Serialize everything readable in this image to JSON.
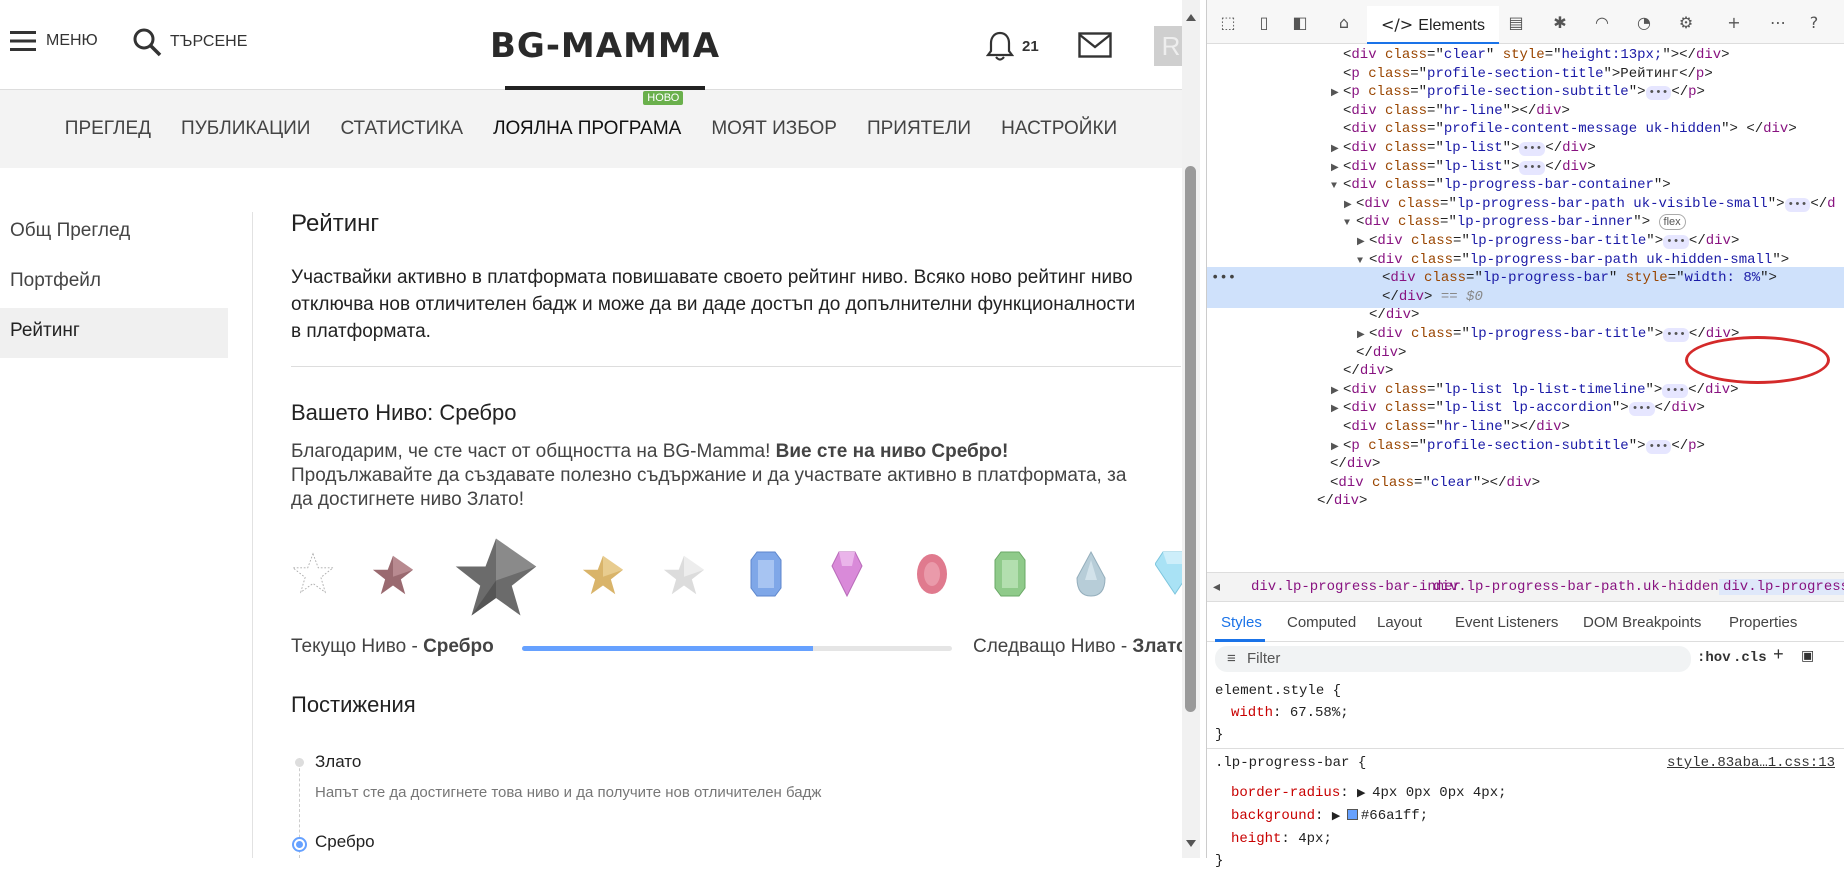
{
  "site": {
    "menu_label": "МЕНЮ",
    "search_label": "ТЪРСЕНЕ",
    "logo_text": "BG-MAMMA",
    "notifications_count": "21",
    "avatar_letter": "R",
    "tabs": [
      {
        "label": "ПРЕГЛЕД"
      },
      {
        "label": "ПУБЛИКАЦИИ"
      },
      {
        "label": "СТАТИСТИКА"
      },
      {
        "label": "ЛОЯЛНА ПРОГРАМА",
        "badge": "НОВО"
      },
      {
        "label": "МОЯТ ИЗБОР"
      },
      {
        "label": "ПРИЯТЕЛИ"
      },
      {
        "label": "НАСТРОЙКИ"
      }
    ],
    "sidebar": [
      {
        "label": "Общ Преглед"
      },
      {
        "label": "Портфейл"
      },
      {
        "label": "Рейтинг"
      }
    ],
    "section_title": "Рейтинг",
    "intro_lines": [
      "Участвайки активно в платформата повишавате своето рейтинг ниво. Всяко ново рейтинг ниво",
      "отключва нов отличителен бадж и може да ви даде достъп до допълнителни функционалности",
      "в платформата."
    ],
    "level_title": "Вашето Ниво: Сребро",
    "thanks_prefix": "Благодарим, че сте част от общността на BG-Mamma! ",
    "thanks_bold": "Вие сте на ниво Сребро!",
    "thanks_line2": "Продължавайте да създавате полезно съдържание и да участвате активно в платформата, за",
    "thanks_line3": "да достигнете ниво Злато!",
    "current_level_label": "Текущо Ниво - ",
    "current_level_value": "Сребро",
    "next_level_label": "Следващо Ниво - ",
    "next_level_value": "Злато",
    "progress_fraction": 0.6758,
    "achievements_title": "Постижения",
    "timeline": [
      {
        "name": "Злато",
        "desc": "Напът сте да достигнете това ниво и да получите нов отличителен бадж"
      },
      {
        "name": "Сребро"
      }
    ],
    "colors": {
      "accent": "#66a1ff",
      "new_badge": "#6ab04c"
    }
  },
  "devtools": {
    "elements_tab": "Elements",
    "dom_lines": [
      {
        "ind": 0,
        "tri": "",
        "html": "&lt;<span class='tg'>div</span> <span class='at'>class</span>=\"<span class='av'>clear</span>\" <span class='at'>style</span>=\"<span class='av'>height:13px;</span>\"&gt;&lt;/<span class='tg'>div</span>&gt;"
      },
      {
        "ind": 0,
        "tri": "",
        "html": "&lt;<span class='tg'>p</span> <span class='at'>class</span>=\"<span class='av'>profile-section-title</span>\"&gt;Рейтинг&lt;/<span class='tg'>p</span>&gt;"
      },
      {
        "ind": 0,
        "tri": "▶",
        "html": "&lt;<span class='tg'>p</span> <span class='at'>class</span>=\"<span class='av'>profile-section-subtitle</span>\"&gt;<span class='ell'>•••</span>&lt;/<span class='tg'>p</span>&gt;"
      },
      {
        "ind": 0,
        "tri": "",
        "html": "&lt;<span class='tg'>div</span> <span class='at'>class</span>=\"<span class='av'>hr-line</span>\"&gt;&lt;/<span class='tg'>div</span>&gt;"
      },
      {
        "ind": 0,
        "tri": "",
        "html": "&lt;<span class='tg'>div</span> <span class='at'>class</span>=\"<span class='av'>profile-content-message uk-hidden</span>\"&gt; &lt;/<span class='tg'>div</span>&gt;"
      },
      {
        "ind": 0,
        "tri": "▶",
        "html": "&lt;<span class='tg'>div</span> <span class='at'>class</span>=\"<span class='av'>lp-list</span>\"&gt;<span class='ell'>•••</span>&lt;/<span class='tg'>div</span>&gt;"
      },
      {
        "ind": 0,
        "tri": "▶",
        "html": "&lt;<span class='tg'>div</span> <span class='at'>class</span>=\"<span class='av'>lp-list</span>\"&gt;<span class='ell'>•••</span>&lt;/<span class='tg'>div</span>&gt;"
      },
      {
        "ind": 0,
        "tri": "▼",
        "html": "&lt;<span class='tg'>div</span> <span class='at'>class</span>=\"<span class='av'>lp-progress-bar-container</span>\"&gt;"
      },
      {
        "ind": 1,
        "tri": "▶",
        "html": "&lt;<span class='tg'>div</span> <span class='at'>class</span>=\"<span class='av'>lp-progress-bar-path uk-visible-small</span>\"&gt;<span class='ell'>•••</span>&lt;/<span class='tg'>d</span>"
      },
      {
        "ind": 1,
        "tri": "▼",
        "html": "&lt;<span class='tg'>div</span> <span class='at'>class</span>=\"<span class='av'>lp-progress-bar-inner</span>\"&gt; <span class='flexb'>flex</span>"
      },
      {
        "ind": 2,
        "tri": "▶",
        "html": "&lt;<span class='tg'>div</span> <span class='at'>class</span>=\"<span class='av'>lp-progress-bar-title</span>\"&gt;<span class='ell'>•••</span>&lt;/<span class='tg'>div</span>&gt;"
      },
      {
        "ind": 2,
        "tri": "▼",
        "html": "&lt;<span class='tg'>div</span> <span class='at'>class</span>=\"<span class='av'>lp-progress-bar-path uk-hidden-small</span>\"&gt;"
      },
      {
        "ind": 3,
        "tri": "",
        "sel": true,
        "html": "&lt;<span class='tg'>div</span> <span class='at'>class</span>=\"<span class='av'>lp-progress-bar</span>\" <span class='at'>style</span>=\"<span class='av'>width:      8%</span>\"&gt;"
      },
      {
        "ind": 3,
        "tri": "",
        "sel": true,
        "html": "&lt;/<span class='tg'>div</span>&gt; <span class='dollar'>== $0</span>"
      },
      {
        "ind": 2,
        "tri": "",
        "html": "&lt;/<span class='tg'>div</span>&gt;"
      },
      {
        "ind": 2,
        "tri": "▶",
        "html": "&lt;<span class='tg'>div</span> <span class='at'>class</span>=\"<span class='av'>lp-progress-bar-title</span>\"&gt;<span class='ell'>•••</span>&lt;/<span class='tg'>div</span>&gt;"
      },
      {
        "ind": 1,
        "tri": "",
        "html": "&lt;/<span class='tg'>div</span>&gt;"
      },
      {
        "ind": 0,
        "tri": "",
        "html": "&lt;/<span class='tg'>div</span>&gt;"
      },
      {
        "ind": 0,
        "tri": "▶",
        "html": "&lt;<span class='tg'>div</span> <span class='at'>class</span>=\"<span class='av'>lp-list lp-list-timeline</span>\"&gt;<span class='ell'>•••</span>&lt;/<span class='tg'>div</span>&gt;"
      },
      {
        "ind": 0,
        "tri": "▶",
        "html": "&lt;<span class='tg'>div</span> <span class='at'>class</span>=\"<span class='av'>lp-list lp-accordion</span>\"&gt;<span class='ell'>•••</span>&lt;/<span class='tg'>div</span>&gt;"
      },
      {
        "ind": 0,
        "tri": "",
        "html": "&lt;<span class='tg'>div</span> <span class='at'>class</span>=\"<span class='av'>hr-line</span>\"&gt;&lt;/<span class='tg'>div</span>&gt;"
      },
      {
        "ind": 0,
        "tri": "▶",
        "html": "&lt;<span class='tg'>p</span> <span class='at'>class</span>=\"<span class='av'>profile-section-subtitle</span>\"&gt;<span class='ell'>•••</span>&lt;/<span class='tg'>p</span>&gt;"
      },
      {
        "ind": -1,
        "tri": "",
        "html": "&lt;/<span class='tg'>div</span>&gt;"
      },
      {
        "ind": -1,
        "tri": "",
        "html": "&lt;<span class='tg'>div</span> <span class='at'>class</span>=\"<span class='av'>clear</span>\"&gt;&lt;/<span class='tg'>div</span>&gt;"
      },
      {
        "ind": -2,
        "tri": "",
        "html": "&lt;/<span class='tg'>div</span>&gt;"
      }
    ],
    "breadcrumbs": [
      "div.lp-progress-bar-inner",
      "div.lp-progress-bar-path.uk-hidden-small",
      "div.lp-progress-ba"
    ],
    "panel_tabs": [
      "Styles",
      "Computed",
      "Layout",
      "Event Listeners",
      "DOM Breakpoints",
      "Properties"
    ],
    "filter_placeholder": "Filter",
    "hov": ":hov",
    "cls": ".cls",
    "element_style_selector": "element.style {",
    "element_style_prop": "width",
    "element_style_value": "67.58%;",
    "rule_selector": ".lp-progress-bar {",
    "rule_source": "style.83aba…1.css:13",
    "rule_props": [
      {
        "name": "border-radius",
        "value": "4px 0px 0px 4px;",
        "arrow": true
      },
      {
        "name": "background",
        "value": "#66a1ff;",
        "arrow": true,
        "swatch": true
      },
      {
        "name": "height",
        "value": "4px;"
      }
    ],
    "close_brace": "}"
  }
}
